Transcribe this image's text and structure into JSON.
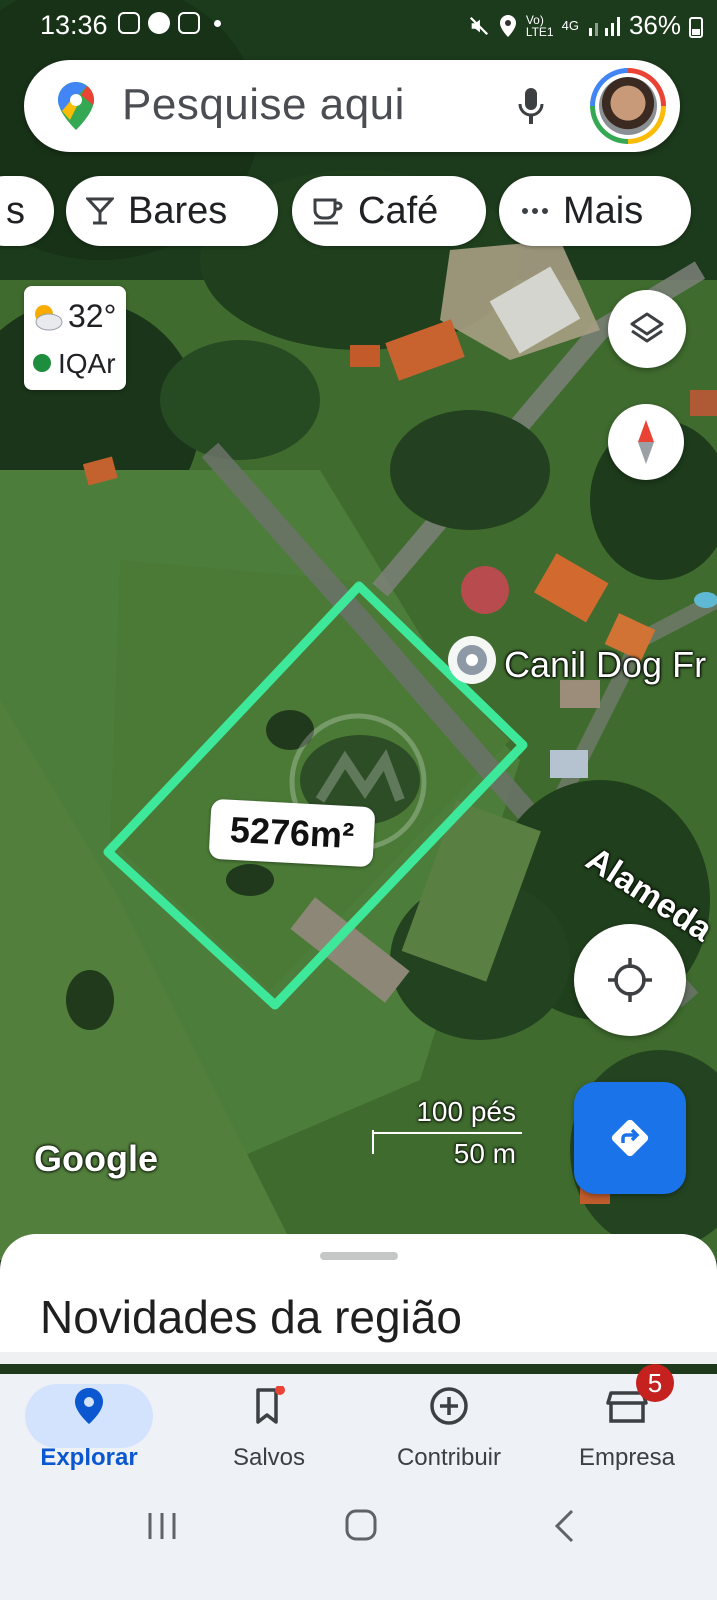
{
  "status_bar": {
    "time": "13:36",
    "battery": "36%",
    "network": "4G",
    "icons": [
      "instagram-icon",
      "telegram-icon",
      "instagram-icon",
      "dot",
      "mute-icon",
      "location-icon",
      "volte-icon",
      "signal-icon",
      "battery-icon"
    ]
  },
  "search": {
    "placeholder": "Pesquise aqui",
    "icons": [
      "maps-pin-icon",
      "mic-icon",
      "avatar"
    ]
  },
  "chips": [
    {
      "label": "s",
      "icon": ""
    },
    {
      "label": "Bares",
      "icon": "cocktail-icon"
    },
    {
      "label": "Café",
      "icon": "coffee-icon"
    },
    {
      "label": "Mais",
      "icon": "more-icon"
    }
  ],
  "weather": {
    "temperature": "32°",
    "aqi_label": "IQAr",
    "icon": "partly-cloudy-icon"
  },
  "map": {
    "area_label": "5276m²",
    "poi_label": "Canil Dog Fr",
    "road_label": "Alameda",
    "attribution": "Google",
    "scale_imperial": "100 pés",
    "scale_metric": "50 m",
    "colors": {
      "polygon": "#3ee89a",
      "nav_fab": "#1a73e8"
    }
  },
  "sheet": {
    "title": "Novidades da região"
  },
  "bottom_nav": [
    {
      "label": "Explorar",
      "icon": "explore-pin-icon",
      "active": true
    },
    {
      "label": "Salvos",
      "icon": "bookmark-icon",
      "active": false
    },
    {
      "label": "Contribuir",
      "icon": "add-circle-icon",
      "active": false
    },
    {
      "label": "Empresa",
      "icon": "storefront-icon",
      "active": false,
      "badge": "5"
    }
  ]
}
